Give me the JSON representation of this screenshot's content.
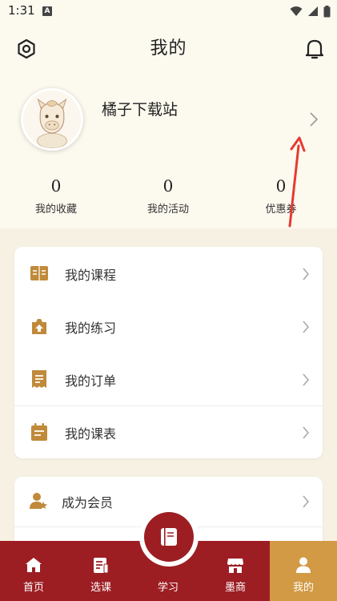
{
  "status_bar": {
    "time": "1:31",
    "badge": "A"
  },
  "header": {
    "title": "我的"
  },
  "profile": {
    "name": "橘子下载站"
  },
  "stats": [
    {
      "count": "0",
      "label": "我的收藏"
    },
    {
      "count": "0",
      "label": "我的活动"
    },
    {
      "count": "0",
      "label": "优惠券"
    }
  ],
  "menu_main": [
    {
      "label": "我的课程",
      "icon": "book-icon"
    },
    {
      "label": "我的练习",
      "icon": "practice-icon"
    },
    {
      "label": "我的订单",
      "icon": "order-icon"
    },
    {
      "label": "我的课表",
      "icon": "calendar-icon"
    }
  ],
  "menu_secondary": [
    {
      "label": "成为会员",
      "icon": "member-icon"
    }
  ],
  "bottom_nav": [
    {
      "label": "首页",
      "icon": "home-icon"
    },
    {
      "label": "选课",
      "icon": "course-select-icon"
    },
    {
      "label": "学习",
      "icon": "study-icon"
    },
    {
      "label": "墨商",
      "icon": "shop-icon"
    },
    {
      "label": "我的",
      "icon": "user-icon",
      "active": true
    }
  ],
  "colors": {
    "brand": "#9c1e23",
    "accent": "#d29a44",
    "icon": "#c08a3a",
    "background": "#f6f1e3",
    "header_bg": "#fcf9ef"
  }
}
